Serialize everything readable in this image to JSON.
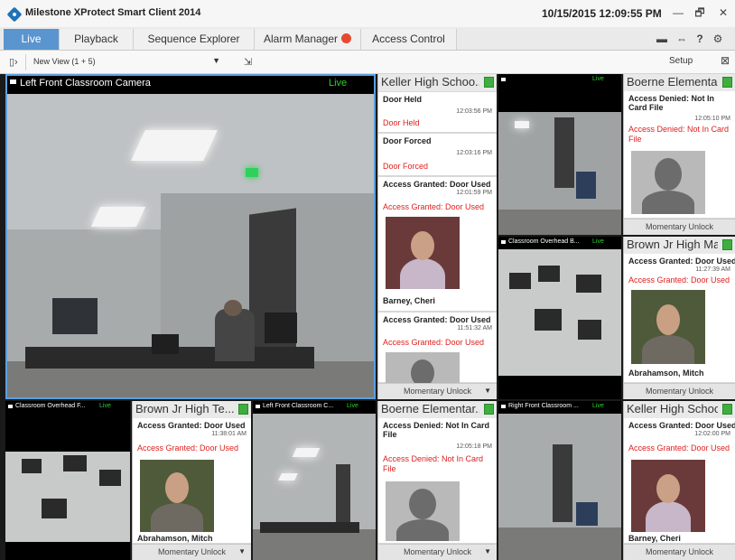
{
  "window": {
    "title": "Milestone XProtect Smart Client 2014",
    "datetime": "10/15/2015 12:09:55 PM",
    "controls": [
      "—",
      "🗗",
      "✕"
    ]
  },
  "tabs": [
    {
      "label": "Live",
      "active": true
    },
    {
      "label": "Playback"
    },
    {
      "label": "Sequence Explorer"
    },
    {
      "label": "Alarm Manager"
    },
    {
      "label": "Access Control"
    }
  ],
  "toolbar_icons": [
    "monitor-icon",
    "link-icon",
    "help-icon",
    "settings-icon"
  ],
  "view": {
    "selector": "New View (1 + 5)",
    "setup_label": "Setup"
  },
  "colors": {
    "accent": "#5b95cf",
    "live_green": "#2bd22b",
    "alert_red": "#e02020",
    "badge_green": "#3fae3f"
  },
  "cameras": {
    "main": {
      "name": "Left Front Classroom Camera",
      "live": "Live"
    },
    "top_right": {
      "name": "",
      "live": "Live"
    },
    "mid_right": {
      "name": "Classroom Overhead B...",
      "live": "Live"
    },
    "bottom_left": {
      "name": "Classroom Overhead F...",
      "live": "Live"
    },
    "bottom_mid": {
      "name": "Left Front Classroom C...",
      "live": "Live"
    },
    "bottom_right": {
      "name": "Right Front Classroom ...",
      "live": "Live"
    }
  },
  "panels": {
    "keller_main": {
      "title": "Keller High Schoo...",
      "events": [
        {
          "title": "Door Held",
          "time": "12:03:56 PM",
          "detail": "Door Held"
        },
        {
          "title": "Door Forced",
          "time": "12:03:16 PM",
          "detail": "Door Forced"
        },
        {
          "title": "Access Granted: Door Used",
          "time": "12:01:59 PM",
          "detail": "Access Granted: Door Used",
          "person": "Barney, Cheri"
        },
        {
          "title": "Access Granted: Door Used",
          "time": "11:51:32 AM",
          "detail": "Access Granted: Door Used"
        }
      ],
      "unlock_label": "Momentary Unlock"
    },
    "boerne_top": {
      "title": "Boerne Elementar...",
      "event": {
        "title": "Access Denied: Not In Card File",
        "time": "12:05:10 PM",
        "detail": "Access Denied: Not In Card File"
      },
      "unlock_label": "Momentary Unlock"
    },
    "brown_top": {
      "title": "Brown Jr High Ma...",
      "event": {
        "title": "Access Granted: Door Used",
        "time": "11:27:39 AM",
        "detail": "Access Granted: Door Used",
        "person": "Abrahamson, Mitch"
      },
      "unlock_label": "Momentary Unlock"
    },
    "brown_bottom": {
      "title": "Brown Jr High Te...",
      "event": {
        "title": "Access Granted: Door Used",
        "time": "11:38:01 AM",
        "detail": "Access Granted: Door Used",
        "person": "Abrahamson, Mitch"
      },
      "unlock_label": "Momentary Unlock"
    },
    "boerne_bottom": {
      "title": "Boerne Elementar...",
      "event": {
        "title": "Access Denied: Not In Card File",
        "time": "12:05:18 PM",
        "detail": "Access Denied: Not In Card File"
      },
      "unlock_label": "Momentary Unlock"
    },
    "keller_bottom": {
      "title": "Keller High Schoo...",
      "event": {
        "title": "Access Granted: Door Used",
        "time": "12:02:00 PM",
        "detail": "Access Granted: Door Used",
        "person": "Barney, Cheri"
      },
      "unlock_label": "Momentary Unlock"
    }
  }
}
